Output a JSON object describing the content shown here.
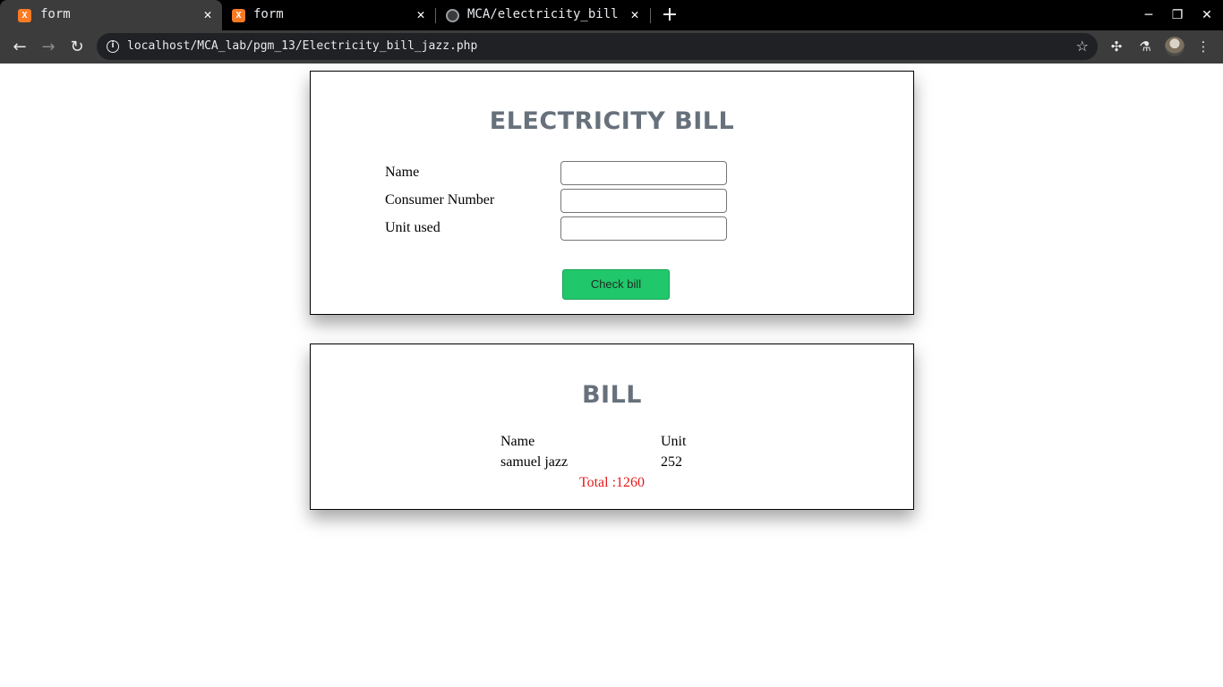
{
  "browser": {
    "tabs": [
      {
        "title": "form",
        "active": true,
        "favicon": "xampp-icon"
      },
      {
        "title": "form",
        "active": false,
        "favicon": "xampp-icon"
      },
      {
        "title": "MCA/electricity_bill.php",
        "active": false,
        "favicon": "github-icon"
      }
    ],
    "url": "localhost/MCA_lab/pgm_13/Electricity_bill_jazz.php"
  },
  "form": {
    "heading": "ELECTRICITY BILL",
    "fields": [
      {
        "label": "Name",
        "value": ""
      },
      {
        "label": "Consumer Number",
        "value": ""
      },
      {
        "label": "Unit used",
        "value": ""
      }
    ],
    "submit_label": "Check bill"
  },
  "bill": {
    "heading": "BILL",
    "columns": [
      "Name",
      "Unit"
    ],
    "row": [
      "samuel jazz",
      "252"
    ],
    "total": "Total :1260"
  },
  "colors": {
    "heading": "#67717c",
    "button": "#21c86b",
    "total": "#e51a1a"
  }
}
